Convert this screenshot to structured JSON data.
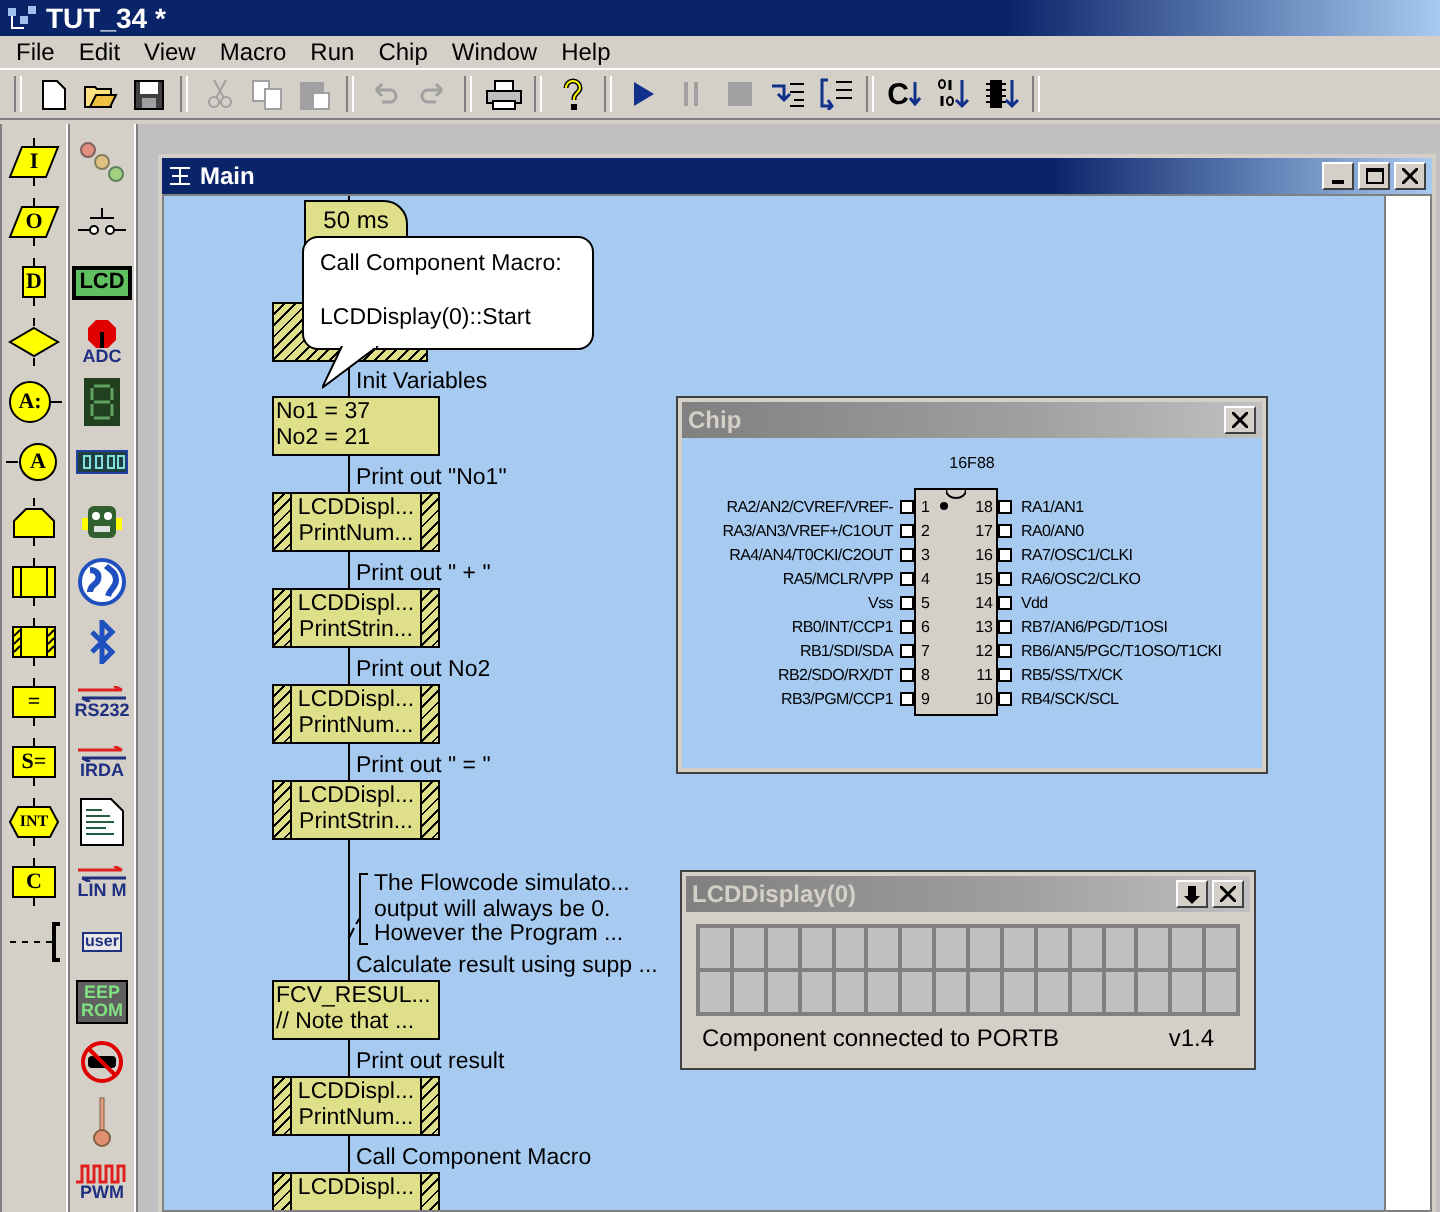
{
  "window": {
    "title": "TUT_34 *",
    "active": true
  },
  "menu": [
    "File",
    "Edit",
    "View",
    "Macro",
    "Run",
    "Chip",
    "Window",
    "Help"
  ],
  "toolbar": {
    "groups": [
      [
        {
          "kind": "new",
          "disabled": false
        },
        {
          "kind": "open",
          "disabled": false
        },
        {
          "kind": "save",
          "disabled": false
        }
      ],
      [
        {
          "kind": "cut",
          "disabled": true
        },
        {
          "kind": "copy",
          "disabled": true
        },
        {
          "kind": "paste",
          "disabled": true
        }
      ],
      [
        {
          "kind": "undo",
          "disabled": true
        },
        {
          "kind": "redo",
          "disabled": true
        }
      ],
      [
        {
          "kind": "print",
          "disabled": false
        }
      ],
      [
        {
          "kind": "help",
          "disabled": false
        }
      ],
      [
        {
          "kind": "run",
          "disabled": false
        },
        {
          "kind": "pause",
          "disabled": true
        },
        {
          "kind": "stop",
          "disabled": true
        },
        {
          "kind": "step-into",
          "disabled": false
        },
        {
          "kind": "step-over",
          "disabled": false
        }
      ],
      [
        {
          "kind": "compile-c",
          "label": "C",
          "disabled": false
        },
        {
          "kind": "compile-hex",
          "disabled": false
        },
        {
          "kind": "compile-chip",
          "disabled": false
        }
      ]
    ]
  },
  "palette": {
    "icons": [
      {
        "kind": "input",
        "label": "I"
      },
      {
        "kind": "output",
        "label": "O"
      },
      {
        "kind": "delay",
        "label": "D"
      },
      {
        "kind": "decision"
      },
      {
        "kind": "connection",
        "label": "A:"
      },
      {
        "kind": "goto",
        "label": "A"
      },
      {
        "kind": "loop"
      },
      {
        "kind": "macro"
      },
      {
        "kind": "component-macro"
      },
      {
        "kind": "calculation",
        "label": "="
      },
      {
        "kind": "string",
        "label": "S="
      },
      {
        "kind": "interrupt",
        "label": "INT"
      },
      {
        "kind": "c-code",
        "label": "C"
      },
      {
        "kind": "comment"
      }
    ],
    "components": [
      {
        "kind": "leds"
      },
      {
        "kind": "switch"
      },
      {
        "kind": "lcd",
        "label": "LCD"
      },
      {
        "kind": "adc",
        "label": "ADC"
      },
      {
        "kind": "seven-segment"
      },
      {
        "kind": "led-digits"
      },
      {
        "kind": "robot"
      },
      {
        "kind": "globe"
      },
      {
        "kind": "bluetooth"
      },
      {
        "kind": "arrows",
        "label": "RS232"
      },
      {
        "kind": "arrows",
        "label": "IRDA"
      },
      {
        "kind": "document"
      },
      {
        "kind": "arrows",
        "label": "LIN M"
      },
      {
        "kind": "user",
        "label": "user"
      },
      {
        "kind": "eeprom",
        "label": "EEP ROM"
      },
      {
        "kind": "no-car"
      },
      {
        "kind": "thermometer"
      },
      {
        "kind": "pwm",
        "label": "PWM"
      }
    ]
  },
  "main": {
    "title": "Main",
    "active": true,
    "flowchart": {
      "delay": "50 ms",
      "balloon": {
        "title": "Call Component Macro:",
        "text": "LCDDisplay(0)::Start"
      },
      "steps": [
        {
          "kind": "calculation",
          "caption": "Init Variables",
          "lines": [
            "No1 = 37",
            "No2 = 21"
          ]
        },
        {
          "kind": "component-macro",
          "caption": "Print out \"No1\"",
          "lines": [
            "LCDDispl...",
            "PrintNum..."
          ]
        },
        {
          "kind": "component-macro",
          "caption": "Print out \" + \"",
          "lines": [
            "LCDDispl...",
            "PrintStrin..."
          ]
        },
        {
          "kind": "component-macro",
          "caption": "Print out No2",
          "lines": [
            "LCDDispl...",
            "PrintNum..."
          ]
        },
        {
          "kind": "component-macro",
          "caption": "Print out \" = \"",
          "lines": [
            "LCDDispl...",
            "PrintStrin..."
          ]
        },
        {
          "kind": "comment",
          "lines": [
            "The Flowcode simulato...",
            "output will always be 0.",
            "However the Program ..."
          ]
        },
        {
          "kind": "calculation",
          "caption": "Calculate result using supp ...",
          "lines": [
            "FCV_RESUL...",
            "// Note that ..."
          ]
        },
        {
          "kind": "component-macro",
          "caption": "Print out result",
          "lines": [
            "LCDDispl...",
            "PrintNum..."
          ]
        },
        {
          "kind": "component-macro",
          "caption": "Call Component Macro",
          "lines": [
            "LCDDispl..."
          ]
        }
      ]
    }
  },
  "chip_window": {
    "title": "Chip",
    "active": false,
    "chip": "16F88",
    "pins_left": [
      {
        "number": "1",
        "label": "RA2/AN2/CVREF/VREF-"
      },
      {
        "number": "2",
        "label": "RA3/AN3/VREF+/C1OUT"
      },
      {
        "number": "3",
        "label": "RA4/AN4/T0CKI/C2OUT"
      },
      {
        "number": "4",
        "label": "RA5/MCLR/VPP"
      },
      {
        "number": "5",
        "label": "Vss"
      },
      {
        "number": "6",
        "label": "RB0/INT/CCP1"
      },
      {
        "number": "7",
        "label": "RB1/SDI/SDA"
      },
      {
        "number": "8",
        "label": "RB2/SDO/RX/DT"
      },
      {
        "number": "9",
        "label": "RB3/PGM/CCP1"
      }
    ],
    "pins_right": [
      {
        "number": "18",
        "label": "RA1/AN1"
      },
      {
        "number": "17",
        "label": "RA0/AN0"
      },
      {
        "number": "16",
        "label": "RA7/OSC1/CLKI"
      },
      {
        "number": "15",
        "label": "RA6/OSC2/CLKO"
      },
      {
        "number": "14",
        "label": "Vdd"
      },
      {
        "number": "13",
        "label": "RB7/AN6/PGD/T1OSI"
      },
      {
        "number": "12",
        "label": "RB6/AN5/PGC/T1OSO/T1CKI"
      },
      {
        "number": "11",
        "label": "RB5/SS/TX/CK"
      },
      {
        "number": "10",
        "label": "RB4/SCK/SCL"
      }
    ]
  },
  "lcd_window": {
    "title": "LCDDisplay(0)",
    "active": false,
    "status": "Component connected to PORTB",
    "version": "v1.4"
  }
}
